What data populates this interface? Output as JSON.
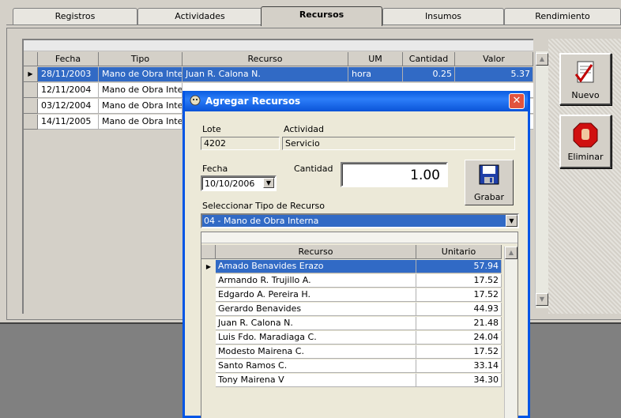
{
  "tabs": [
    "Registros",
    "Actividades",
    "Recursos",
    "Insumos",
    "Rendimiento"
  ],
  "active_tab": "Recursos",
  "records": {
    "columns": [
      "Fecha",
      "Tipo",
      "Recurso",
      "UM",
      "Cantidad",
      "Valor"
    ],
    "rows": [
      {
        "fecha": "28/11/2003",
        "tipo": "Mano de Obra Interi",
        "recurso": "Juan R. Calona N.",
        "um": "hora",
        "cantidad": "0.25",
        "valor": "5.37"
      },
      {
        "fecha": "12/11/2004",
        "tipo": "Mano de Obra Interi",
        "recurso": "",
        "um": "",
        "cantidad": "",
        "valor": ""
      },
      {
        "fecha": "03/12/2004",
        "tipo": "Mano de Obra Interi",
        "recurso": "",
        "um": "",
        "cantidad": "",
        "valor": ""
      },
      {
        "fecha": "14/11/2005",
        "tipo": "Mano de Obra Interi",
        "recurso": "",
        "um": "",
        "cantidad": "",
        "valor": ""
      }
    ]
  },
  "buttons": {
    "nuevo": "Nuevo",
    "eliminar": "Eliminar"
  },
  "dialog": {
    "title": "Agregar Recursos",
    "close": "✕",
    "lote_label": "Lote",
    "lote_value": "4202",
    "actividad_label": "Actividad",
    "actividad_value": "Servicio",
    "fecha_label": "Fecha",
    "fecha_value": "10/10/2006",
    "cantidad_label": "Cantidad",
    "cantidad_value": "1.00",
    "grabar_label": "Grabar",
    "tipo_label": "Seleccionar Tipo de Recurso",
    "tipo_value": "04 - Mano de Obra Interna",
    "resources": {
      "columns": [
        "Recurso",
        "Unitario"
      ],
      "rows": [
        {
          "recurso": "Amado Benavides Erazo",
          "unitario": "57.94"
        },
        {
          "recurso": "Armando R. Trujillo A.",
          "unitario": "17.52"
        },
        {
          "recurso": "Edgardo A. Pereira H.",
          "unitario": "17.52"
        },
        {
          "recurso": "Gerardo Benavides",
          "unitario": "44.93"
        },
        {
          "recurso": "Juan R. Calona N.",
          "unitario": "21.48"
        },
        {
          "recurso": "Luis Fdo. Maradiaga C.",
          "unitario": "24.04"
        },
        {
          "recurso": "Modesto Mairena C.",
          "unitario": "17.52"
        },
        {
          "recurso": "Santo Ramos C.",
          "unitario": "33.14"
        },
        {
          "recurso": "Tony Mairena V",
          "unitario": "34.30"
        }
      ]
    }
  },
  "colors": {
    "selection": "#316ac5",
    "titlebar": "#0a5ce0",
    "close": "#e2533e"
  }
}
